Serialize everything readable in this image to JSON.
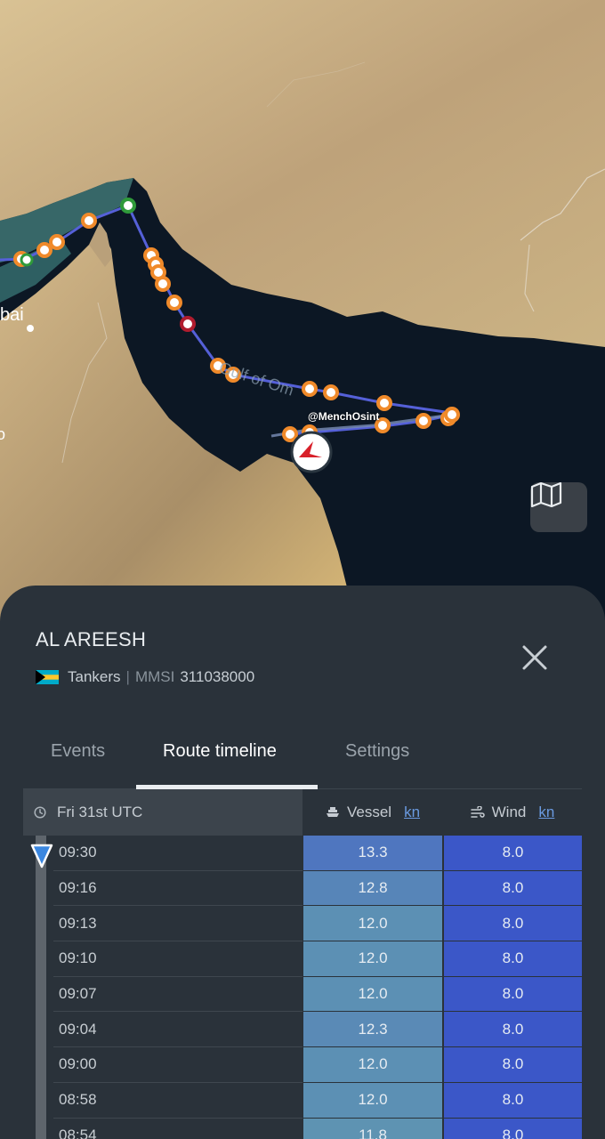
{
  "map": {
    "place_label": "bai",
    "place_label_left": "o",
    "watermark": "@MenchOsint",
    "gulf_label": "Gulf of Om",
    "layers_button_icon": "map-icon"
  },
  "vessel": {
    "name": "AL AREESH",
    "type": "Tankers",
    "mmsi_label": "MMSI",
    "mmsi": "311038000",
    "flag": "bahamas-flag"
  },
  "tabs": [
    {
      "label": "Events"
    },
    {
      "label": "Route timeline"
    },
    {
      "label": "Settings"
    }
  ],
  "active_tab": "Route timeline",
  "table": {
    "date_header": "Fri 31st UTC",
    "vessel_header": "Vessel",
    "vessel_unit": "kn",
    "wind_header": "Wind",
    "wind_unit": "kn",
    "rows": [
      {
        "time": "09:30",
        "vessel": "13.3",
        "wind": "8.0",
        "vessel_color": "#4f76bf"
      },
      {
        "time": "09:16",
        "vessel": "12.8",
        "wind": "8.0",
        "vessel_color": "#5785b8"
      },
      {
        "time": "09:13",
        "vessel": "12.0",
        "wind": "8.0",
        "vessel_color": "#5c90b4"
      },
      {
        "time": "09:10",
        "vessel": "12.0",
        "wind": "8.0",
        "vessel_color": "#5c90b4"
      },
      {
        "time": "09:07",
        "vessel": "12.0",
        "wind": "8.0",
        "vessel_color": "#5c90b4"
      },
      {
        "time": "09:04",
        "vessel": "12.3",
        "wind": "8.0",
        "vessel_color": "#5a8ab6"
      },
      {
        "time": "09:00",
        "vessel": "12.0",
        "wind": "8.0",
        "vessel_color": "#5c90b4"
      },
      {
        "time": "08:58",
        "vessel": "12.0",
        "wind": "8.0",
        "vessel_color": "#5c90b4"
      },
      {
        "time": "08:54",
        "vessel": "11.8",
        "wind": "8.0",
        "vessel_color": "#5e93b2"
      }
    ]
  },
  "colors": {
    "wind_cell": "#3b57c8",
    "route_line": "#5560d8",
    "waypoint": "#f08a2a",
    "sea": "#0c1724",
    "land": "#c9b183"
  }
}
